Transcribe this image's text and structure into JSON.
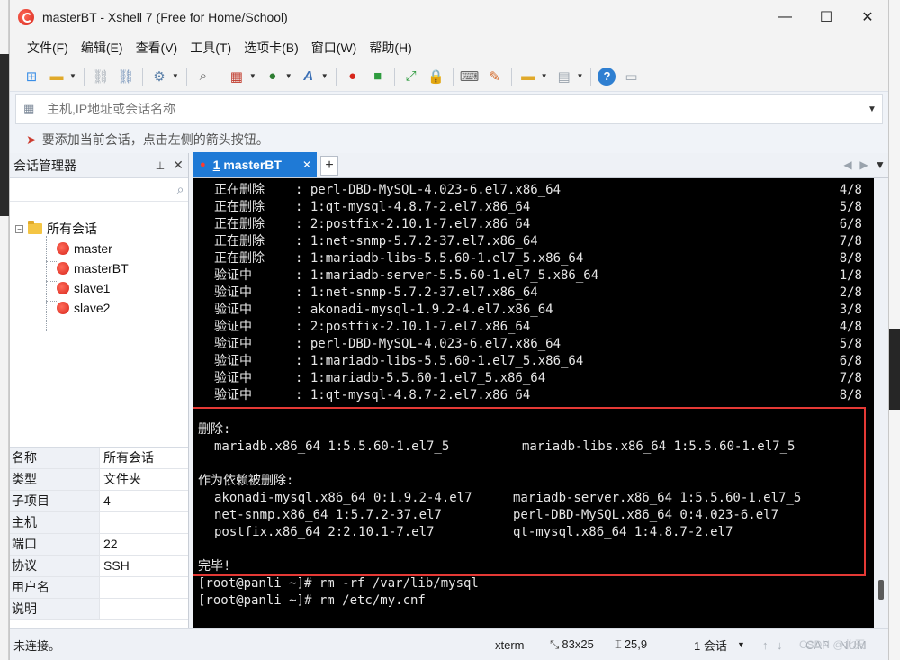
{
  "window": {
    "title": "masterBT - Xshell 7 (Free for Home/School)",
    "minimize": "—",
    "maximize": "☐",
    "close": "✕"
  },
  "menu": [
    "文件(F)",
    "编辑(E)",
    "查看(V)",
    "工具(T)",
    "选项卡(B)",
    "窗口(W)",
    "帮助(H)"
  ],
  "address": {
    "placeholder": "主机,IP地址或会话名称"
  },
  "hint": {
    "text": "要添加当前会话，点击左侧的箭头按钮。"
  },
  "sidebar": {
    "title": "会话管理器",
    "pin": "📌",
    "close": "✕",
    "root": "所有会话",
    "sessions": [
      "master",
      "masterBT",
      "slave1",
      "slave2"
    ],
    "properties": [
      {
        "key": "名称",
        "value": "所有会话"
      },
      {
        "key": "类型",
        "value": "文件夹"
      },
      {
        "key": "子项目",
        "value": "4"
      },
      {
        "key": "主机",
        "value": ""
      },
      {
        "key": "端口",
        "value": "22"
      },
      {
        "key": "协议",
        "value": "SSH"
      },
      {
        "key": "用户名",
        "value": ""
      },
      {
        "key": "说明",
        "value": ""
      }
    ]
  },
  "tabs": {
    "active": {
      "index": "1",
      "label": "masterBT"
    }
  },
  "terminal": {
    "erase_lines": [
      {
        "action": "正在删除",
        "pkg": ": perl-DBD-MySQL-4.023-6.el7.x86_64",
        "progress": "4/8"
      },
      {
        "action": "正在删除",
        "pkg": ": 1:qt-mysql-4.8.7-2.el7.x86_64",
        "progress": "5/8"
      },
      {
        "action": "正在删除",
        "pkg": ": 2:postfix-2.10.1-7.el7.x86_64",
        "progress": "6/8"
      },
      {
        "action": "正在删除",
        "pkg": ": 1:net-snmp-5.7.2-37.el7.x86_64",
        "progress": "7/8"
      },
      {
        "action": "正在删除",
        "pkg": ": 1:mariadb-libs-5.5.60-1.el7_5.x86_64",
        "progress": "8/8"
      },
      {
        "action": "验证中",
        "pkg": ": 1:mariadb-server-5.5.60-1.el7_5.x86_64",
        "progress": "1/8"
      },
      {
        "action": "验证中",
        "pkg": ": 1:net-snmp-5.7.2-37.el7.x86_64",
        "progress": "2/8"
      },
      {
        "action": "验证中",
        "pkg": ": akonadi-mysql-1.9.2-4.el7.x86_64",
        "progress": "3/8"
      },
      {
        "action": "验证中",
        "pkg": ": 2:postfix-2.10.1-7.el7.x86_64",
        "progress": "4/8"
      },
      {
        "action": "验证中",
        "pkg": ": perl-DBD-MySQL-4.023-6.el7.x86_64",
        "progress": "5/8"
      },
      {
        "action": "验证中",
        "pkg": ": 1:mariadb-libs-5.5.60-1.el7_5.x86_64",
        "progress": "6/8"
      },
      {
        "action": "验证中",
        "pkg": ": 1:mariadb-5.5.60-1.el7_5.x86_64",
        "progress": "7/8"
      },
      {
        "action": "验证中",
        "pkg": ": 1:qt-mysql-4.8.7-2.el7.x86_64",
        "progress": "8/8"
      }
    ],
    "removed_heading": "删除:",
    "removed": [
      "mariadb.x86_64 1:5.5.60-1.el7_5",
      "mariadb-libs.x86_64 1:5.5.60-1.el7_5"
    ],
    "deps_heading": "作为依赖被删除:",
    "deps": [
      [
        "akonadi-mysql.x86_64 0:1.9.2-4.el7",
        "mariadb-server.x86_64 1:5.5.60-1.el7_5"
      ],
      [
        "net-snmp.x86_64 1:5.7.2-37.el7",
        "perl-DBD-MySQL.x86_64 0:4.023-6.el7"
      ],
      [
        "postfix.x86_64 2:2.10.1-7.el7",
        "qt-mysql.x86_64 1:4.8.7-2.el7"
      ]
    ],
    "done": "完毕!",
    "commands": [
      "[root@panli ~]# rm -rf /var/lib/mysql",
      "[root@panli ~]# rm /etc/my.cnf"
    ]
  },
  "status": {
    "connection": "未连接。",
    "terminal_type": "xterm",
    "size": "83x25",
    "cursor": "25,9",
    "sessions": "1 会话",
    "cap": "CAP",
    "num": "NUM"
  },
  "watermark": "CSDN @北天"
}
